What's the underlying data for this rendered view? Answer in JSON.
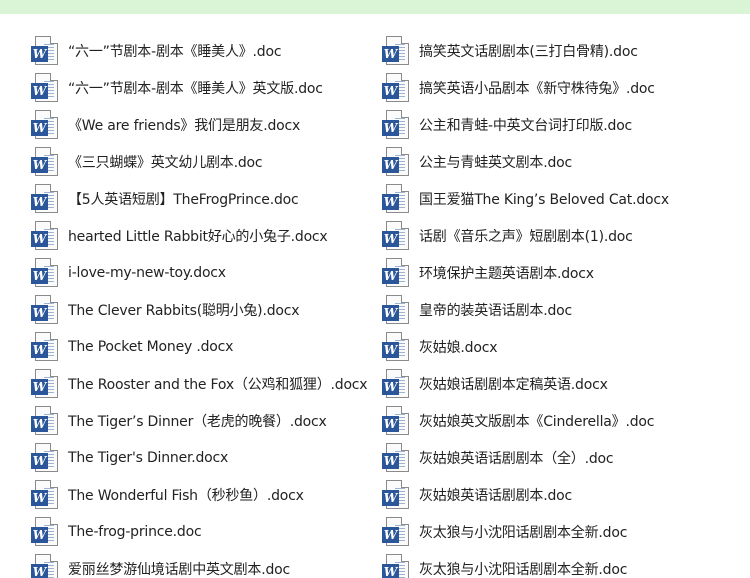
{
  "icons": {
    "word_badge": "W"
  },
  "colors": {
    "top_bar": "#d9f5d6",
    "word_blue": "#2b579a"
  },
  "files": {
    "left": [
      "“六一”节剧本-剧本《睡美人》.doc",
      "“六一”节剧本-剧本《睡美人》英文版.doc",
      "《We are friends》我们是朋友.docx",
      "《三只蝴蝶》英文幼儿剧本.doc",
      "【5人英语短剧】TheFrogPrince.doc",
      "hearted Little Rabbit好心的小兔子.docx",
      "i-love-my-new-toy.docx",
      "The Clever Rabbits(聪明小兔).docx",
      "The Pocket Money .docx",
      "The Rooster and the Fox（公鸡和狐狸）.docx",
      "The Tiger’s Dinner（老虎的晚餐）.docx",
      "The Tiger's Dinner.docx",
      "The Wonderful Fish（秒秒鱼）.docx",
      "The-frog-prince.doc",
      "爱丽丝梦游仙境话剧中英文剧本.doc"
    ],
    "right": [
      "搞笑英文话剧剧本(三打白骨精).doc",
      "搞笑英语小品剧本《新守株待兔》.doc",
      "公主和青蛙-中英文台词打印版.doc",
      "公主与青蛙英文剧本.doc",
      "国王爱猫The King’s Beloved Cat.docx",
      "话剧《音乐之声》短剧剧本(1).doc",
      "环境保护主题英语剧本.docx",
      "皇帝的装英语话剧本.doc",
      "灰姑娘.docx",
      "灰姑娘话剧剧本定稿英语.docx",
      "灰姑娘英文版剧本《Cinderella》.doc",
      "灰姑娘英语话剧剧本（全）.doc",
      "灰姑娘英语话剧剧本.doc",
      "灰太狼与小沈阳话剧剧本全新.doc",
      "灰太狼与小沈阳话剧剧本全新.doc"
    ]
  }
}
